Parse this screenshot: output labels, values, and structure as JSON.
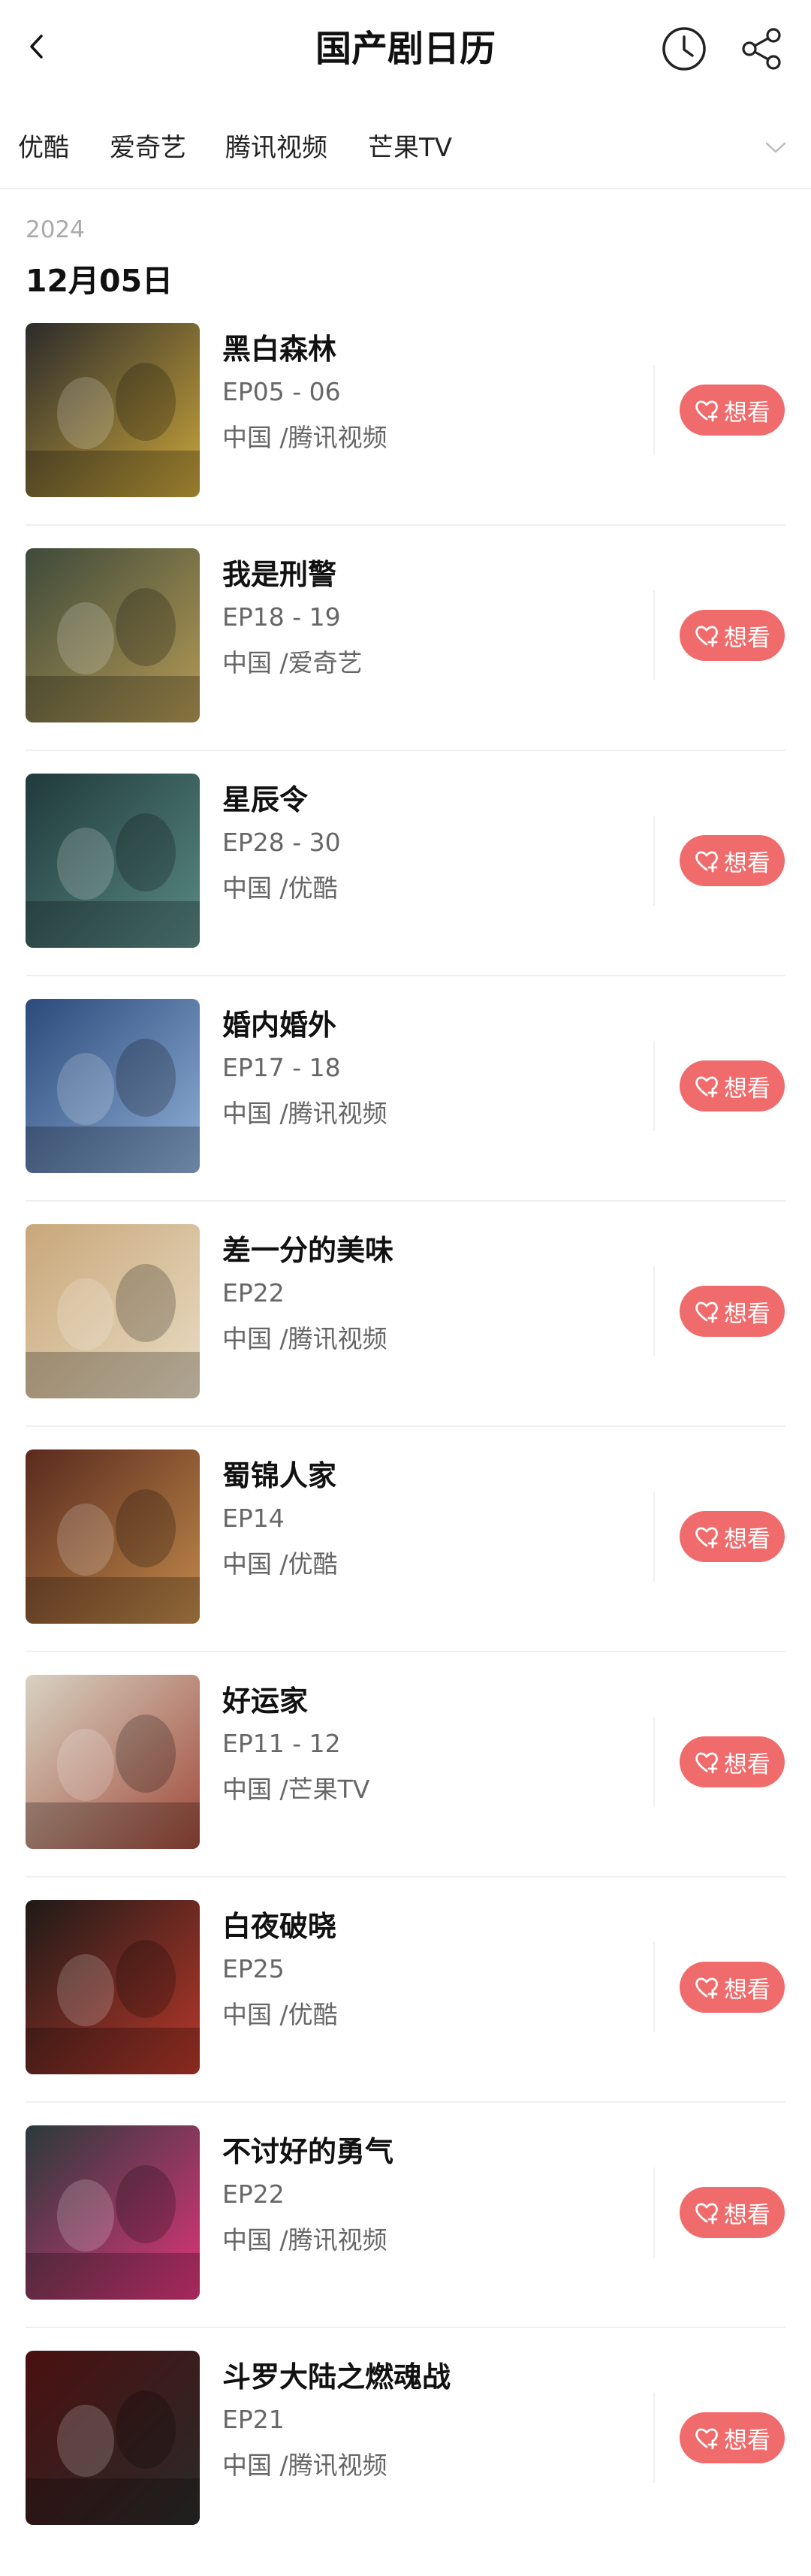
{
  "header": {
    "title": "国产剧日历",
    "back_icon": "chevron-left-icon",
    "history_icon": "clock-icon",
    "share_icon": "share-icon"
  },
  "tabs": [
    "优酷",
    "爱奇艺",
    "腾讯视频",
    "芒果TV"
  ],
  "year": "2024",
  "date": "12月05日",
  "colors": {
    "accent": "#f06b6b",
    "text": "#111111",
    "muted": "#666666"
  },
  "want_label": "想看",
  "items": [
    {
      "title": "黑白森林",
      "ep": "EP05 - 06",
      "info": "中国 /腾讯视频",
      "poster_colors": [
        "#2b2b2b",
        "#caa53a"
      ]
    },
    {
      "title": "我是刑警",
      "ep": "EP18 - 19",
      "info": "中国 /爱奇艺",
      "poster_colors": [
        "#3e4a3a",
        "#b59a55"
      ]
    },
    {
      "title": "星辰令",
      "ep": "EP28 - 30",
      "info": "中国 /优酷",
      "poster_colors": [
        "#1f3a3a",
        "#5a8a84"
      ]
    },
    {
      "title": "婚内婚外",
      "ep": "EP17 - 18",
      "info": "中国 /腾讯视频",
      "poster_colors": [
        "#2c4a7a",
        "#8fb0d8"
      ]
    },
    {
      "title": "差一分的美味",
      "ep": "EP22",
      "info": "中国 /腾讯视频",
      "poster_colors": [
        "#c9a77a",
        "#e8dcc4"
      ]
    },
    {
      "title": "蜀锦人家",
      "ep": "EP14",
      "info": "中国 /优酷",
      "poster_colors": [
        "#5a2a1e",
        "#c08a4a"
      ]
    },
    {
      "title": "好运家",
      "ep": "EP11 - 12",
      "info": "中国 /芒果TV",
      "poster_colors": [
        "#d8d2c2",
        "#a04a3a"
      ]
    },
    {
      "title": "白夜破晓",
      "ep": "EP25",
      "info": "中国 /优酷",
      "poster_colors": [
        "#1e1a18",
        "#b8382a"
      ]
    },
    {
      "title": "不讨好的勇气",
      "ep": "EP22",
      "info": "中国 /腾讯视频",
      "poster_colors": [
        "#2a3a3a",
        "#e0357a"
      ]
    },
    {
      "title": "斗罗大陆之燃魂战",
      "ep": "EP21",
      "info": "中国 /腾讯视频",
      "poster_colors": [
        "#4a1010",
        "#2a2a2a"
      ]
    }
  ]
}
